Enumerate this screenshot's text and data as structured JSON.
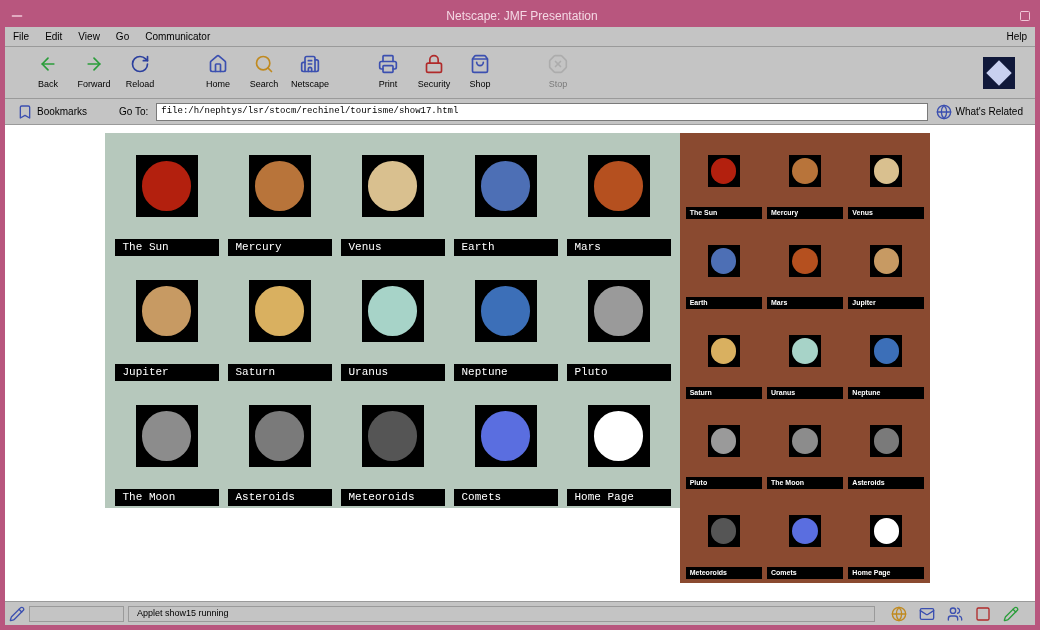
{
  "window": {
    "title": "Netscape: JMF Presentation"
  },
  "menu": [
    "File",
    "Edit",
    "View",
    "Go",
    "Communicator"
  ],
  "help_menu": "Help",
  "toolbar": [
    {
      "label": "Back",
      "disabled": false
    },
    {
      "label": "Forward",
      "disabled": false
    },
    {
      "label": "Reload",
      "disabled": false
    },
    {
      "label": "Home",
      "disabled": false
    },
    {
      "label": "Search",
      "disabled": false
    },
    {
      "label": "Netscape",
      "disabled": false
    },
    {
      "label": "Print",
      "disabled": false
    },
    {
      "label": "Security",
      "disabled": false
    },
    {
      "label": "Shop",
      "disabled": false
    },
    {
      "label": "Stop",
      "disabled": true
    }
  ],
  "location_bar": {
    "bookmarks": "Bookmarks",
    "go_to": "Go To:",
    "url": "file:/h/nephtys/lsr/stocm/rechinel/tourisme/show17.html",
    "whats_related": "What's Related"
  },
  "page": {
    "main_grid": [
      "The Sun",
      "Mercury",
      "Venus",
      "Earth",
      "Mars",
      "Jupiter",
      "Saturn",
      "Uranus",
      "Neptune",
      "Pluto",
      "The Moon",
      "Asteroids",
      "Meteoroids",
      "Comets",
      "Home Page"
    ],
    "side_grid": [
      "The Sun",
      "Mercury",
      "Venus",
      "Earth",
      "Mars",
      "Jupiter",
      "Saturn",
      "Uranus",
      "Neptune",
      "Pluto",
      "The Moon",
      "Asteroids",
      "Meteoroids",
      "Comets",
      "Home Page"
    ]
  },
  "status_bar": {
    "text": "Applet show15 running"
  }
}
